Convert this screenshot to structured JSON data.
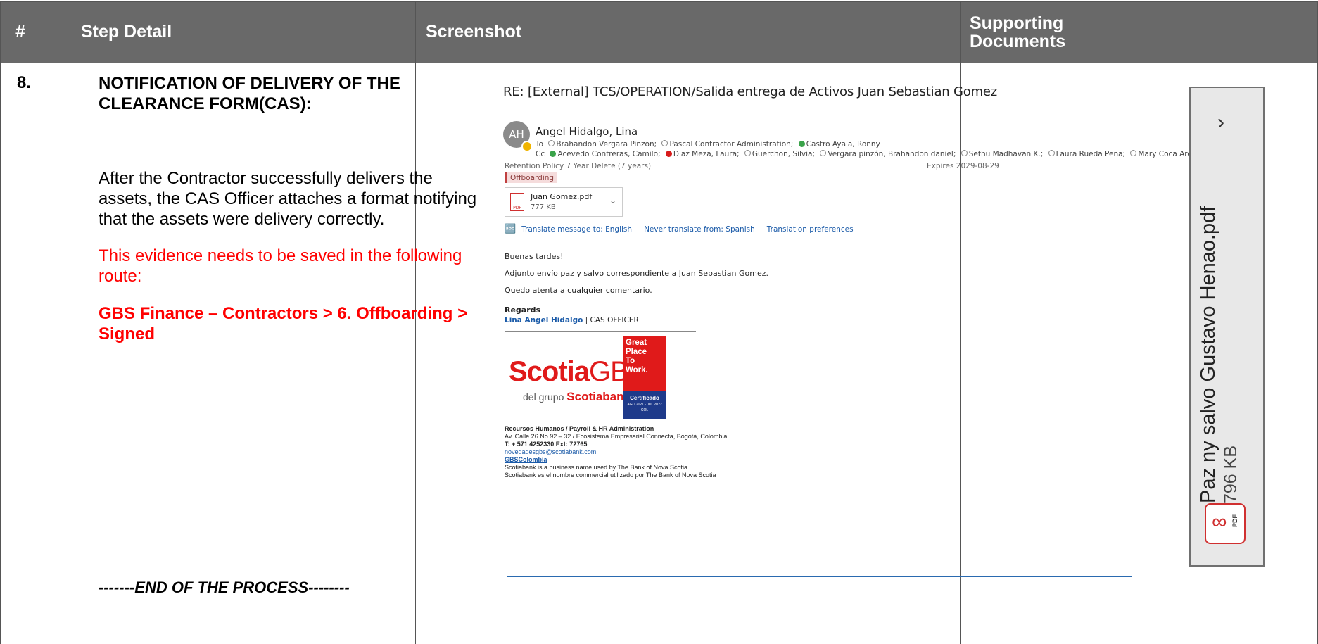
{
  "header": {
    "num": "#",
    "step_detail": "Step Detail",
    "screenshot": "Screenshot",
    "supporting_1": "Supporting",
    "supporting_2": "Documents"
  },
  "row": {
    "num": "8.",
    "title": "NOTIFICATION OF DELIVERY OF THE CLEARANCE FORM(CAS):",
    "description": "After the Contractor successfully delivers the assets, the CAS Officer attaches a format notifying that the assets were delivery correctly.",
    "evidence_note": "This evidence needs to be saved in the following route:",
    "route": "GBS Finance – Contractors > 6. Offboarding > Signed",
    "end": "-------END OF THE PROCESS--------"
  },
  "email": {
    "subject": "RE: [External] TCS/OPERATION/Salida entrega de Activos Juan Sebastian Gomez",
    "avatar": "AH",
    "sender": "Angel Hidalgo, Lina",
    "to_label": "To",
    "to": [
      "Brahandon Vergara Pinzon;",
      "Pascal Contractor Administration;",
      "Castro Ayala, Ronny"
    ],
    "cc_label": "Cc",
    "cc": [
      "Acevedo Contreras, Camilo;",
      "Diaz Meza, Laura;",
      "Guerchon, Silvia;",
      "Vergara pinzón, Brahandon daniel;",
      "Sethu Madhavan K.;",
      "Laura Rueda Pena;",
      "Mary Coca Ardila;"
    ],
    "retention": "Retention Policy  7 Year Delete (7 years)",
    "expires": "Expires  2029-08-29",
    "tag": "Offboarding",
    "attachment_name": "Juan Gomez.pdf",
    "attachment_size": "777 KB",
    "translate": "Translate message to: English",
    "never_translate": "Never translate from: Spanish",
    "translation_prefs": "Translation preferences",
    "greeting": "Buenas tardes!",
    "body1": "Adjunto envío paz y salvo correspondiente a Juan Sebastian Gomez.",
    "body2": "Quedo atenta a cualquier comentario.",
    "regards": "Regards",
    "sig_name": "Lina Angel Hidalgo",
    "sig_role": "| CAS OFFICER",
    "logo_scotia": "Scotia",
    "logo_gbs": "GBS",
    "logo_sub_pre": "del grupo ",
    "logo_sub_brand": "Scotiabank",
    "gptw": [
      "Great",
      "Place",
      "To",
      "Work."
    ],
    "gptw_cert": "Certificado",
    "gptw_small": "AGO 2021 - JUL 2022",
    "gptw_country": "COL",
    "footer": [
      "Recursos Humanos / Payroll & HR Administration",
      "Av. Calle 26 No 92 – 32 / Ecosistema Empresarial Connecta, Bogotá, Colombia",
      "T: + 571 4252330 Ext: 72765",
      "novedadesgbs@scotiabank.com",
      "GBSColombia",
      "Scotiabank is a business name used by The Bank of Nova Scotia.",
      "Scotiabank es el nombre commercial utilizado por The Bank of Nova Scotia"
    ]
  },
  "supporting_doc": {
    "name": "Paz ny salvo Gustavo Henao.pdf",
    "size": "796 KB",
    "icon_label": "PDF"
  }
}
